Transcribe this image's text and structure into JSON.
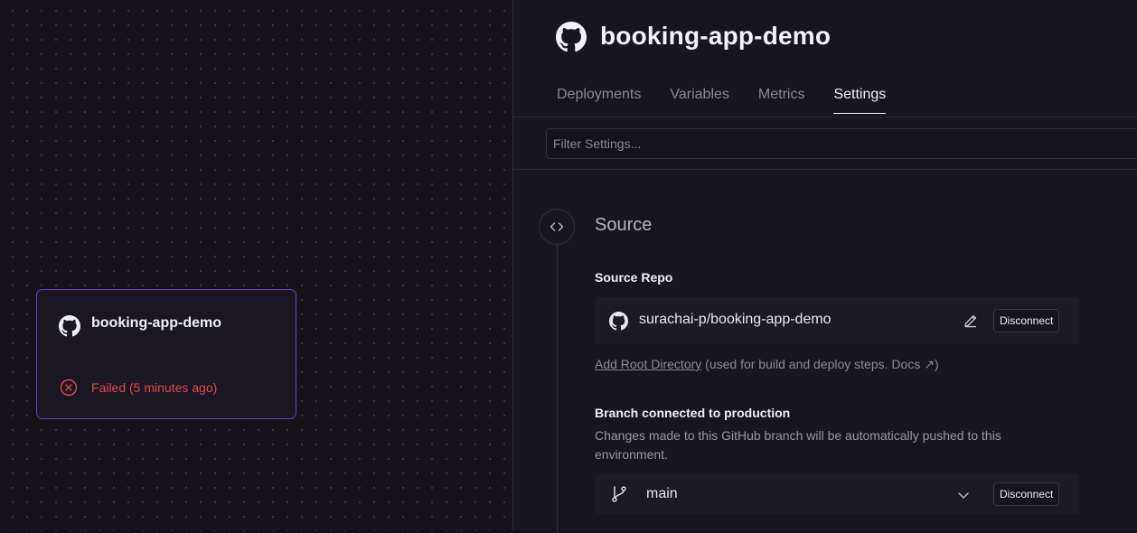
{
  "canvas": {
    "service_card": {
      "name": "booking-app-demo",
      "status": "Failed (5 minutes ago)",
      "status_color": "#e5484d",
      "border_color": "#6d3fc0",
      "icon": "github-icon",
      "status_icon": "x-circle-icon"
    }
  },
  "panel": {
    "service_name": "booking-app-demo",
    "tabs": [
      {
        "label": "Deployments",
        "active": false
      },
      {
        "label": "Variables",
        "active": false
      },
      {
        "label": "Metrics",
        "active": false
      },
      {
        "label": "Settings",
        "active": true
      }
    ],
    "filter": {
      "placeholder": "Filter Settings..."
    },
    "source": {
      "title": "Source",
      "icon": "code-icon",
      "repo_label": "Source Repo",
      "repo_name": "surachai-p/booking-app-demo",
      "disconnect_label": "Disconnect",
      "add_root_dir": "Add Root Directory",
      "root_dir_hint_prefix": "(used for build and deploy steps. ",
      "docs_label": "Docs ↗",
      "root_dir_hint_suffix": ")",
      "branch_label": "Branch connected to production",
      "branch_desc": "Changes made to this GitHub branch will be automatically pushed to this environment.",
      "branch_name": "main",
      "branch_disconnect_label": "Disconnect"
    }
  }
}
